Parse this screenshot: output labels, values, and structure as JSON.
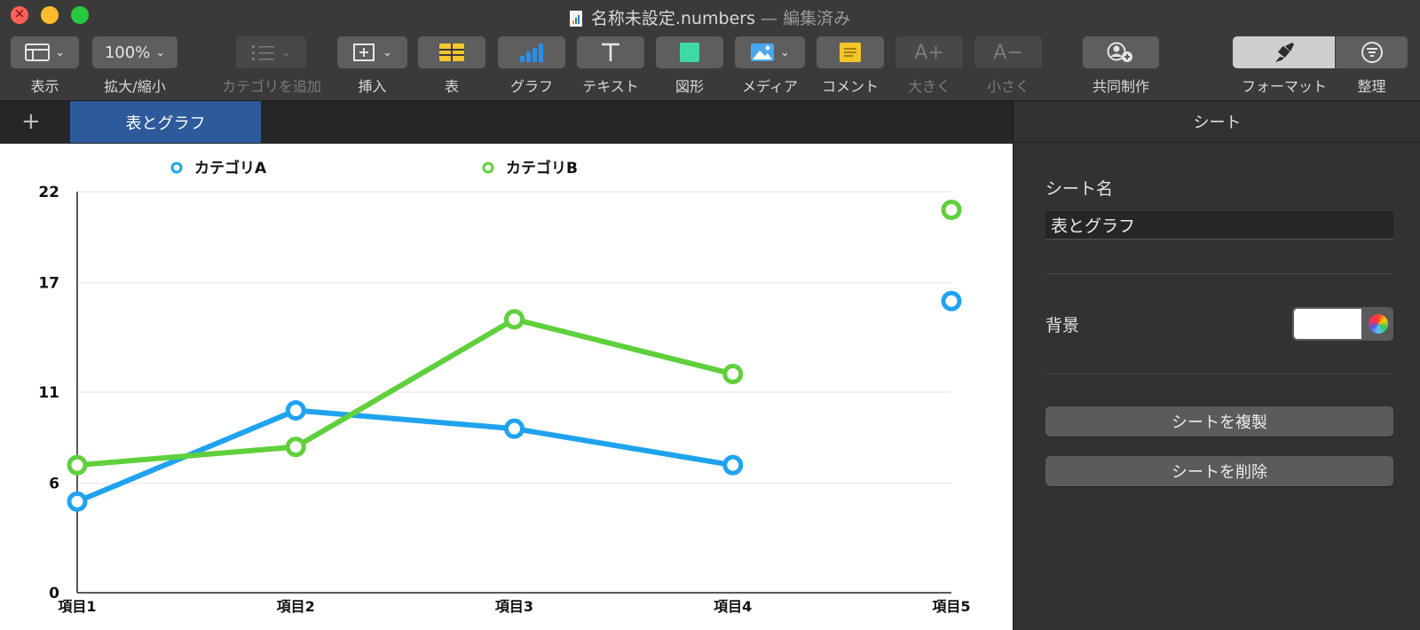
{
  "window": {
    "title": "名称未設定.numbers",
    "status": "— 編集済み"
  },
  "toolbar": {
    "view_label": "表示",
    "zoom_value": "100%",
    "zoom_label": "拡大/縮小",
    "add_category_label": "カテゴリを追加",
    "insert_label": "挿入",
    "table_label": "表",
    "chart_label": "グラフ",
    "text_label": "テキスト",
    "shape_label": "図形",
    "media_label": "メディア",
    "comment_label": "コメント",
    "bigger_label": "大きく",
    "smaller_label": "小さく",
    "collaborate_label": "共同制作",
    "format_label": "フォーマット",
    "organize_label": "整理",
    "bigger_icon_text": "A+",
    "smaller_icon_text": "A−"
  },
  "tabs": {
    "add": "+",
    "items": [
      {
        "label": "表とグラフ",
        "active": true
      }
    ]
  },
  "sidebar": {
    "header": "シート",
    "sheet_name_label": "シート名",
    "sheet_name_value": "表とグラフ",
    "background_label": "背景",
    "background_color": "#ffffff",
    "duplicate_button": "シートを複製",
    "delete_button": "シートを削除"
  },
  "chart_data": {
    "type": "line",
    "categories": [
      "項目1",
      "項目2",
      "項目3",
      "項目4",
      "項目5"
    ],
    "series": [
      {
        "name": "カテゴリA",
        "color": "#1fa3f0",
        "values": [
          5,
          10,
          9,
          7,
          16
        ]
      },
      {
        "name": "カテゴリB",
        "color": "#5fd03b",
        "values": [
          7,
          8,
          15,
          12,
          21
        ]
      }
    ],
    "gaps_between": [
      [
        3,
        4
      ]
    ],
    "yticks": [
      0,
      6,
      11,
      17,
      22
    ],
    "ylim": [
      0,
      22
    ],
    "grid": true,
    "legend": "top"
  }
}
